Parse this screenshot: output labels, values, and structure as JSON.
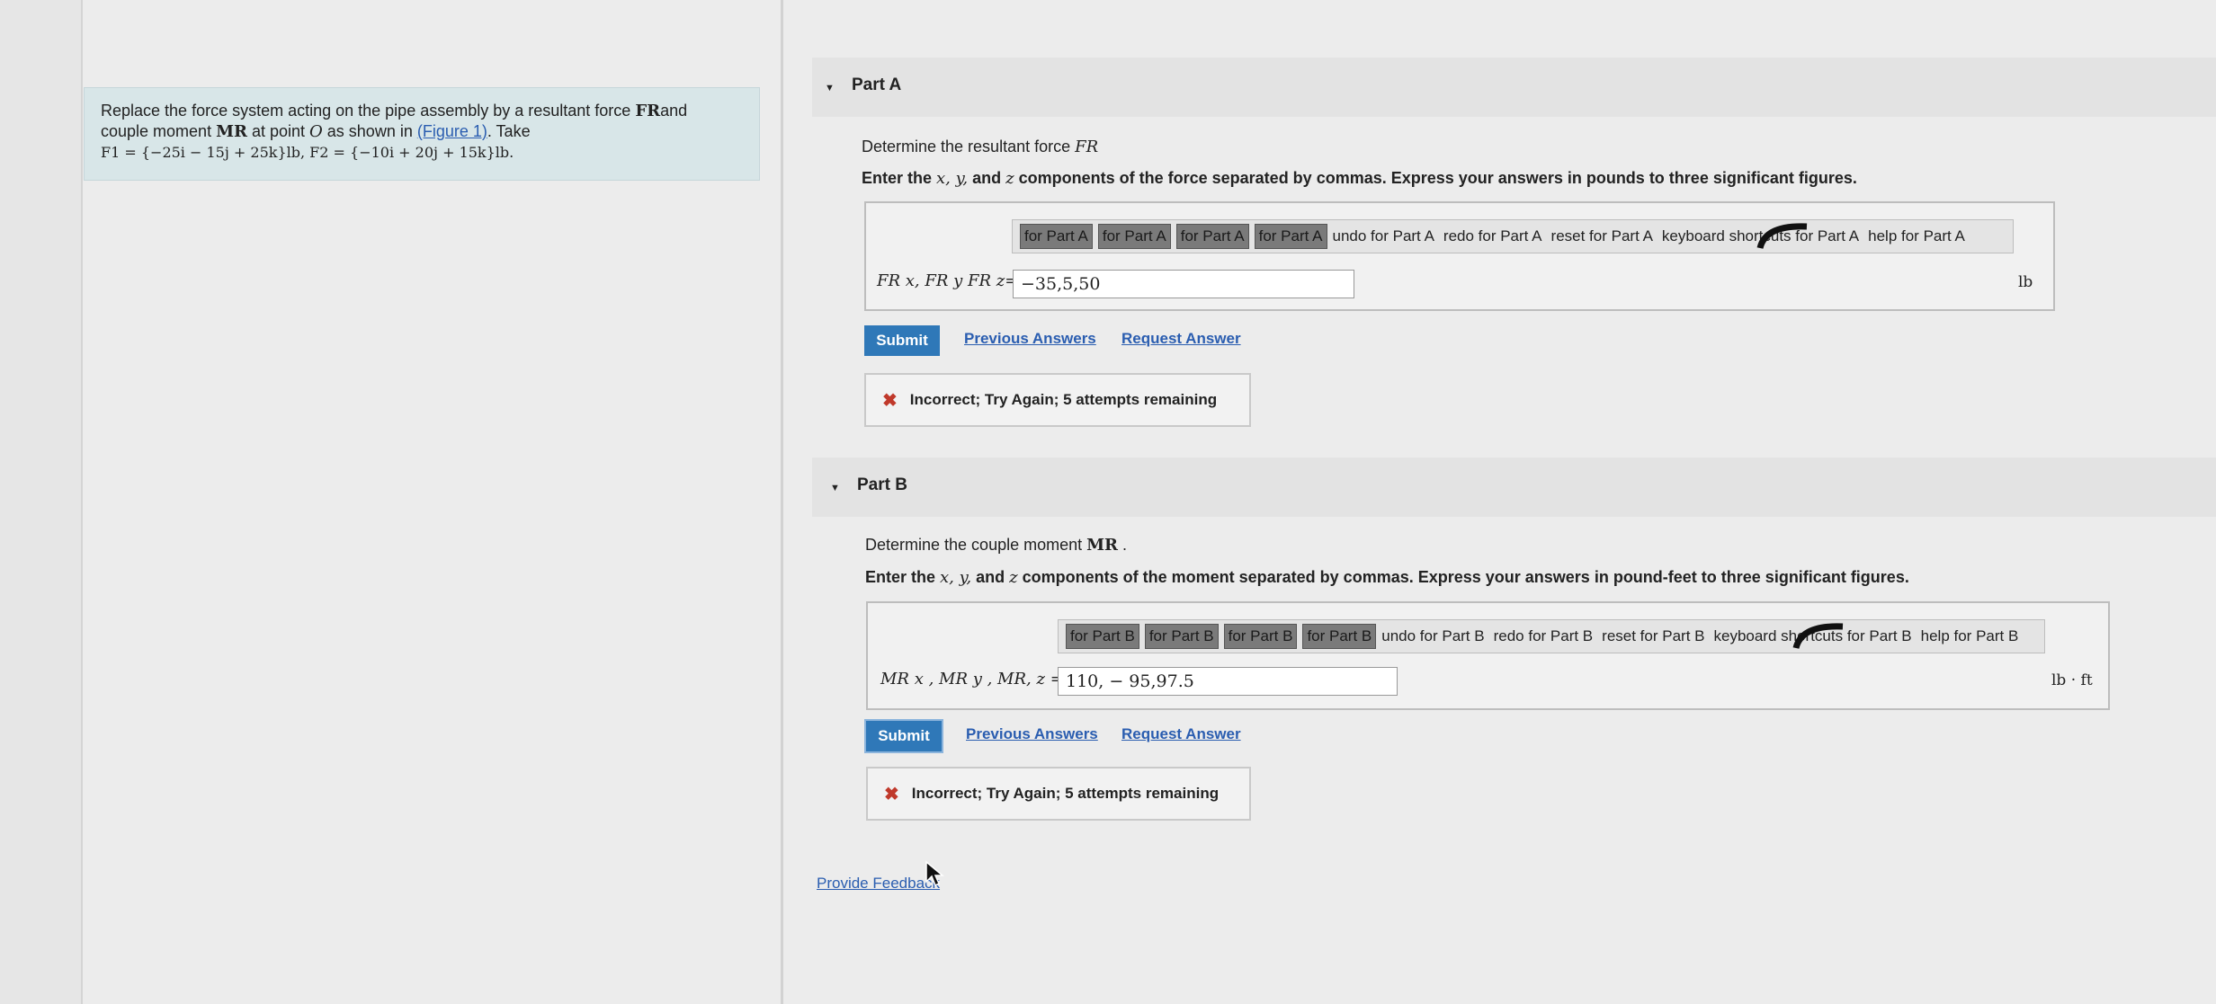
{
  "problem": {
    "line1_pre": "Replace the force system acting on the pipe assembly by a resultant force ",
    "fr_symbol": "FR",
    "line1_post": "and",
    "line2_pre": "couple moment ",
    "mr_symbol": "MR",
    "line2_mid": " at point ",
    "point": "O",
    "line2_post": " as shown in ",
    "figure_link": "(Figure 1)",
    "line2_end": ". Take",
    "line3": "F1 = {−25i − 15j + 25k}lb, F2 = {−10i + 20j + 15k}lb."
  },
  "part_a": {
    "title": "Part A",
    "prompt_pre": "Determine the resultant force ",
    "prompt_symbol": "FR",
    "instruction_pre": "Enter the ",
    "instruction_vars": "x, y,",
    "instruction_and": " and ",
    "instruction_z": "z",
    "instruction_post": " components of the force separated by commas. Express your answers in pounds to three significant figures.",
    "toolbar": {
      "btn1": "for Part A",
      "btn2": "for Part A",
      "btn3": "for Part A",
      "btn4": "for Part A",
      "undo": "undo for Part A",
      "redo": "redo for Part A",
      "reset": "reset for Part A",
      "keyboard": "keyboard shortcuts for Part A",
      "help": "help for Part A"
    },
    "field_label": "FR x, FR y FR z=",
    "answer": "−35,5,50",
    "unit": "lb",
    "submit": "Submit",
    "previous": "Previous Answers",
    "request": "Request Answer",
    "feedback": "Incorrect; Try Again; 5 attempts remaining"
  },
  "part_b": {
    "title": "Part B",
    "prompt_pre": "Determine the couple moment ",
    "prompt_symbol": "MR",
    "prompt_post": " .",
    "instruction_pre": "Enter the ",
    "instruction_vars": "x, y,",
    "instruction_and": " and ",
    "instruction_z": "z",
    "instruction_post": " components of the moment separated by commas. Express your answers in pound-feet to three significant figures.",
    "toolbar": {
      "btn1": "for Part B",
      "btn2": "for Part B",
      "btn3": "for Part B",
      "btn4": "for Part B",
      "undo": "undo for Part B",
      "redo": "redo for Part B",
      "reset": "reset for Part B",
      "keyboard": "keyboard shortcuts for Part B",
      "help": "help for Part B"
    },
    "field_label": "MR x , MR y , MR, z =",
    "answer": "110, − 95,97.5",
    "unit": "lb · ft",
    "submit": "Submit",
    "previous": "Previous Answers",
    "request": "Request Answer",
    "feedback": "Incorrect; Try Again; 5 attempts remaining"
  },
  "provide_feedback": "Provide Feedback",
  "colors": {
    "submit_bg": "#2f78b8",
    "link": "#2a5db0",
    "error_x": "#c0392b",
    "problem_bg": "#d8e6e8"
  }
}
